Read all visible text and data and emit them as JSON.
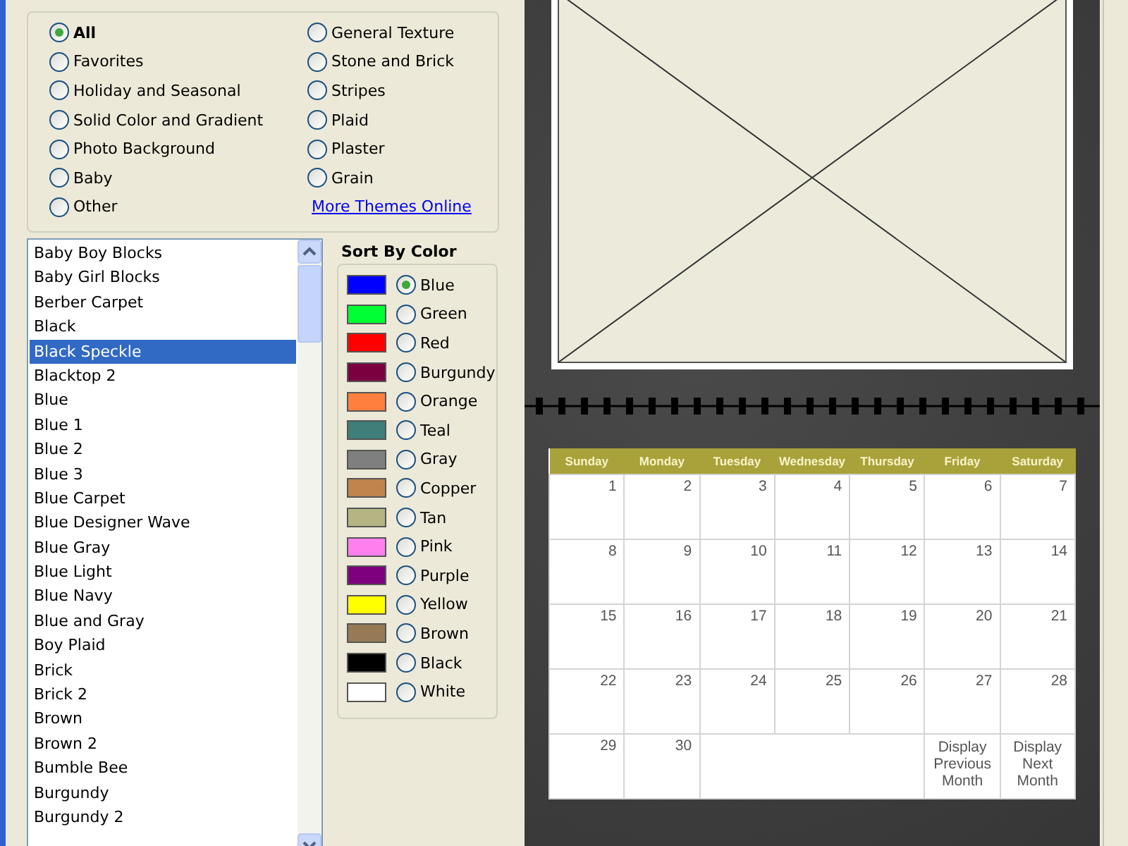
{
  "categories": [
    {
      "label": "All",
      "selected": true
    },
    {
      "label": "Favorites",
      "selected": false
    },
    {
      "label": "Holiday and Seasonal",
      "selected": false
    },
    {
      "label": "Solid Color and Gradient",
      "selected": false
    },
    {
      "label": "Photo Background",
      "selected": false
    },
    {
      "label": "Baby",
      "selected": false
    },
    {
      "label": "Other",
      "selected": false
    },
    {
      "label": "General Texture",
      "selected": false
    },
    {
      "label": "Stone and Brick",
      "selected": false
    },
    {
      "label": "Stripes",
      "selected": false
    },
    {
      "label": "Plaid",
      "selected": false
    },
    {
      "label": "Plaster",
      "selected": false
    },
    {
      "label": "Grain",
      "selected": false
    }
  ],
  "more_link": "More Themes Online",
  "themes": [
    {
      "label": "Baby Boy Blocks",
      "selected": false
    },
    {
      "label": "Baby Girl Blocks",
      "selected": false
    },
    {
      "label": "Berber Carpet",
      "selected": false
    },
    {
      "label": "Black",
      "selected": false
    },
    {
      "label": "Black Speckle",
      "selected": true
    },
    {
      "label": "Blacktop 2",
      "selected": false
    },
    {
      "label": "Blue",
      "selected": false
    },
    {
      "label": "Blue 1",
      "selected": false
    },
    {
      "label": "Blue 2",
      "selected": false
    },
    {
      "label": "Blue 3",
      "selected": false
    },
    {
      "label": "Blue Carpet",
      "selected": false
    },
    {
      "label": "Blue Designer Wave",
      "selected": false
    },
    {
      "label": "Blue Gray",
      "selected": false
    },
    {
      "label": "Blue Light",
      "selected": false
    },
    {
      "label": "Blue Navy",
      "selected": false
    },
    {
      "label": "Blue and Gray",
      "selected": false
    },
    {
      "label": "Boy Plaid",
      "selected": false
    },
    {
      "label": "Brick",
      "selected": false
    },
    {
      "label": "Brick 2",
      "selected": false
    },
    {
      "label": "Brown",
      "selected": false
    },
    {
      "label": "Brown 2",
      "selected": false
    },
    {
      "label": "Bumble Bee",
      "selected": false
    },
    {
      "label": "Burgundy",
      "selected": false
    },
    {
      "label": "Burgundy 2",
      "selected": false
    }
  ],
  "sort_by_color": {
    "title": "Sort By Color",
    "colors": [
      {
        "label": "Blue",
        "color": "#0000ff",
        "selected": true
      },
      {
        "label": "Green",
        "color": "#00ff33",
        "selected": false
      },
      {
        "label": "Red",
        "color": "#ff0000",
        "selected": false
      },
      {
        "label": "Burgundy",
        "color": "#7a0040",
        "selected": false
      },
      {
        "label": "Orange",
        "color": "#ff7f3f",
        "selected": false
      },
      {
        "label": "Teal",
        "color": "#3f7f7a",
        "selected": false
      },
      {
        "label": "Gray",
        "color": "#7f7f7f",
        "selected": false
      },
      {
        "label": "Copper",
        "color": "#c0844c",
        "selected": false
      },
      {
        "label": "Tan",
        "color": "#b5b584",
        "selected": false
      },
      {
        "label": "Pink",
        "color": "#ff7fef",
        "selected": false
      },
      {
        "label": "Purple",
        "color": "#7f007f",
        "selected": false
      },
      {
        "label": "Yellow",
        "color": "#ffff00",
        "selected": false
      },
      {
        "label": "Brown",
        "color": "#957a55",
        "selected": false
      },
      {
        "label": "Black",
        "color": "#000000",
        "selected": false
      },
      {
        "label": "White",
        "color": "#ffffff",
        "selected": false
      }
    ]
  },
  "calendar": {
    "headers": [
      "Sunday",
      "Monday",
      "Tuesday",
      "Wednesday",
      "Thursday",
      "Friday",
      "Saturday"
    ],
    "weeks": [
      [
        {
          "kind": "day",
          "text": "1"
        },
        {
          "kind": "day",
          "text": "2"
        },
        {
          "kind": "day",
          "text": "3"
        },
        {
          "kind": "day",
          "text": "4"
        },
        {
          "kind": "day",
          "text": "5"
        },
        {
          "kind": "day",
          "text": "6"
        },
        {
          "kind": "day",
          "text": "7"
        }
      ],
      [
        {
          "kind": "day",
          "text": "8"
        },
        {
          "kind": "day",
          "text": "9"
        },
        {
          "kind": "day",
          "text": "10"
        },
        {
          "kind": "day",
          "text": "11"
        },
        {
          "kind": "day",
          "text": "12"
        },
        {
          "kind": "day",
          "text": "13"
        },
        {
          "kind": "day",
          "text": "14"
        }
      ],
      [
        {
          "kind": "day",
          "text": "15"
        },
        {
          "kind": "day",
          "text": "16"
        },
        {
          "kind": "day",
          "text": "17"
        },
        {
          "kind": "day",
          "text": "18"
        },
        {
          "kind": "day",
          "text": "19"
        },
        {
          "kind": "day",
          "text": "20"
        },
        {
          "kind": "day",
          "text": "21"
        }
      ],
      [
        {
          "kind": "day",
          "text": "22"
        },
        {
          "kind": "day",
          "text": "23"
        },
        {
          "kind": "day",
          "text": "24"
        },
        {
          "kind": "day",
          "text": "25"
        },
        {
          "kind": "day",
          "text": "26"
        },
        {
          "kind": "day",
          "text": "27"
        },
        {
          "kind": "day",
          "text": "28"
        }
      ],
      [
        {
          "kind": "day",
          "text": "29"
        },
        {
          "kind": "day",
          "text": "30"
        },
        {
          "kind": "blank"
        },
        {
          "kind": "nav",
          "text": "Display Previous Month"
        },
        {
          "kind": "nav",
          "text": "Display Next Month"
        }
      ]
    ]
  }
}
